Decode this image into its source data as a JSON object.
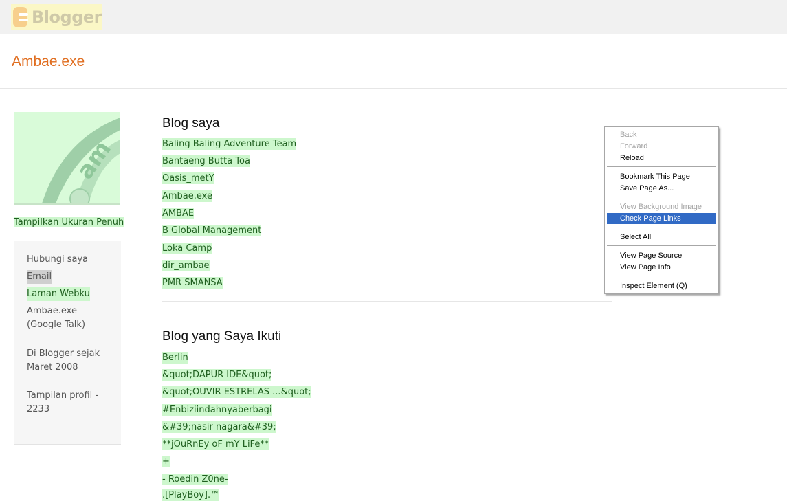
{
  "header": {
    "logo_text": "Blogger",
    "blog_title": "Ambae.exe"
  },
  "sidebar": {
    "show_full_size": "Tampilkan Ukuran Penuh",
    "avatar_text": "am",
    "contact_heading": "Hubungi saya",
    "email": "Email",
    "website": "Laman Webku",
    "gtalk_line1": "Ambae.exe",
    "gtalk_line2": "(Google Talk)",
    "since_line1": "Di Blogger sejak",
    "since_line2": "Maret 2008",
    "views_line1": "Tampilan profil -",
    "views_line2": "2233"
  },
  "my_blogs": {
    "heading": "Blog saya",
    "items": [
      "Baling Baling Adventure Team",
      "Bantaeng Butta Toa",
      "Oasis_metY",
      "Ambae.exe",
      "AMBAE",
      "B Global Management",
      "Loka Camp",
      "dir_ambae",
      "PMR SMANSA"
    ]
  },
  "followed_blogs": {
    "heading": "Blog yang Saya Ikuti",
    "items": [
      "Berlin",
      "&quot;DAPUR IDE&quot;",
      "&quot;OUVIR ESTRELAS ...&quot;",
      "#Enbiziindahnyaberbagi",
      "&#39;nasir nagara&#39;",
      "**jOuRnEy oF mY LiFe**",
      "+",
      "- Roedin Z0ne-",
      ".[PlayBoy].™"
    ]
  },
  "context_menu": {
    "back": "Back",
    "forward": "Forward",
    "reload": "Reload",
    "bookmark": "Bookmark This Page",
    "save_as": "Save Page As...",
    "view_bg": "View Background Image",
    "check_links": "Check Page Links",
    "select_all": "Select All",
    "view_source": "View Page Source",
    "view_info": "View Page Info",
    "inspect": "Inspect Element (Q)"
  }
}
